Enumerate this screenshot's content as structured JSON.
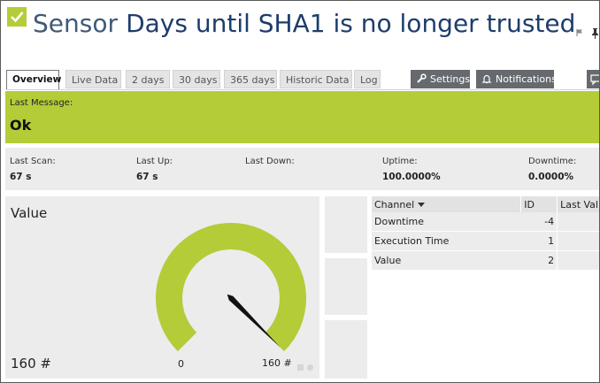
{
  "header": {
    "status_icon": "check-icon",
    "prefix": "Sensor",
    "name": "Days until SHA1 is no longer trusted"
  },
  "tabs": [
    {
      "label": "Overview",
      "active": true
    },
    {
      "label": "Live Data",
      "active": false
    },
    {
      "label": "2 days",
      "active": false
    },
    {
      "label": "30 days",
      "active": false
    },
    {
      "label": "365 days",
      "active": false
    },
    {
      "label": "Historic Data",
      "active": false
    },
    {
      "label": "Log",
      "active": false
    }
  ],
  "toolbar": {
    "settings_label": "Settings",
    "notifications_label": "Notifications"
  },
  "message": {
    "label": "Last Message:",
    "value": "Ok"
  },
  "stats": {
    "last_scan_label": "Last Scan:",
    "last_scan_value": "67 s",
    "last_up_label": "Last Up:",
    "last_up_value": "67 s",
    "last_down_label": "Last Down:",
    "last_down_value": "",
    "uptime_label": "Uptime:",
    "uptime_value": "100.0000%",
    "downtime_label": "Downtime:",
    "downtime_value": "0.0000%"
  },
  "gauge": {
    "title": "Value",
    "value_text": "160 #",
    "min_label": "0",
    "max_label": "160 #",
    "min": 0,
    "max": 160,
    "current": 160,
    "color": "#b4cc38"
  },
  "channels": {
    "headers": {
      "channel": "Channel",
      "id": "ID",
      "last_value": "Last Val"
    },
    "rows": [
      {
        "channel": "Downtime",
        "id": "-4"
      },
      {
        "channel": "Execution Time",
        "id": "1"
      },
      {
        "channel": "Value",
        "id": "2"
      }
    ]
  },
  "colors": {
    "status_ok": "#b4cc38",
    "title_blue": "#1e3d6b",
    "button_gray": "#666a6e"
  }
}
